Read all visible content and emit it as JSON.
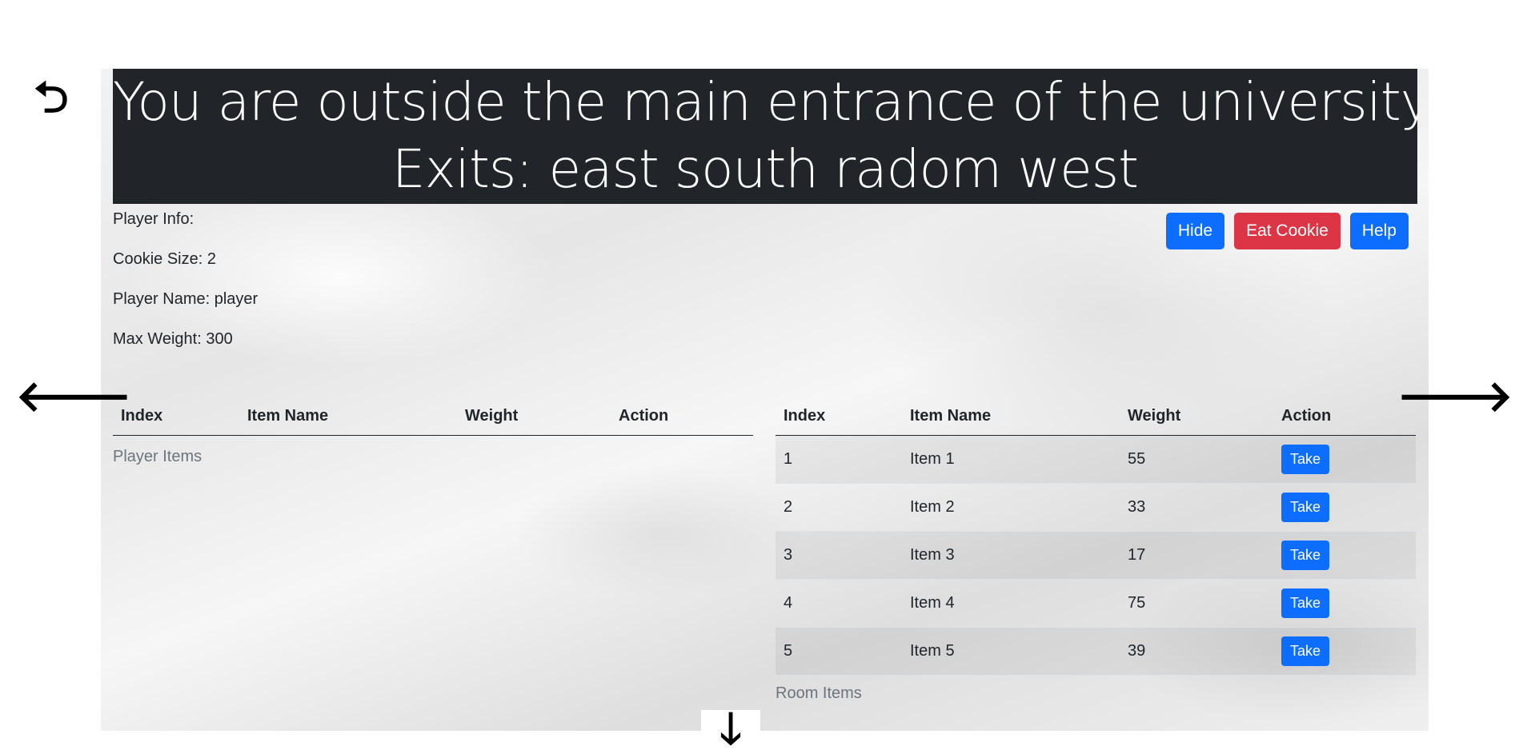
{
  "banner": {
    "line1": "You are outside the main entrance of the university.",
    "line2": "Exits: east south radom west"
  },
  "nav": {
    "back": "⮌",
    "left": "🡐",
    "right": "🡒",
    "down": "🡓"
  },
  "player_info": {
    "heading": "Player Info:",
    "cookie_size": "Cookie Size: 2",
    "player_name": "Player Name: player",
    "max_weight": "Max Weight: 300"
  },
  "buttons": {
    "hide": "Hide",
    "eat_cookie": "Eat Cookie",
    "help": "Help"
  },
  "player_table": {
    "headers": [
      "Index",
      "Item Name",
      "Weight",
      "Action"
    ],
    "caption": "Player Items"
  },
  "room_table": {
    "headers": [
      "Index",
      "Item Name",
      "Weight",
      "Action"
    ],
    "rows": [
      {
        "index": "1",
        "name": "Item 1",
        "weight": "55",
        "action": "Take"
      },
      {
        "index": "2",
        "name": "Item 2",
        "weight": "33",
        "action": "Take"
      },
      {
        "index": "3",
        "name": "Item 3",
        "weight": "17",
        "action": "Take"
      },
      {
        "index": "4",
        "name": "Item 4",
        "weight": "75",
        "action": "Take"
      },
      {
        "index": "5",
        "name": "Item 5",
        "weight": "39",
        "action": "Take"
      }
    ],
    "caption": "Room Items"
  },
  "colors": {
    "banner_bg": "#212529",
    "primary": "#0d6efd",
    "danger": "#dc3545",
    "muted": "#6c757d"
  }
}
